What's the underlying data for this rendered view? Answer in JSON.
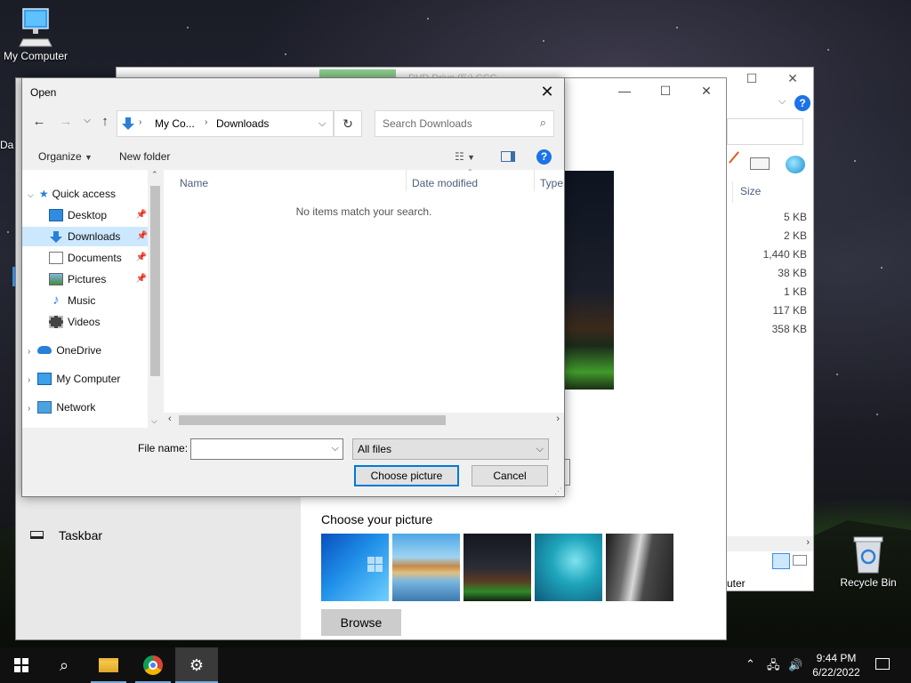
{
  "desktop": {
    "icons": {
      "my_computer": "My Computer",
      "recycle_bin": "Recycle Bin",
      "partial_left": "Da"
    }
  },
  "back_window": {
    "sizes": [
      "5 KB",
      "2 KB",
      "1,440 KB",
      "38 KB",
      "1 KB",
      "117 KB",
      "358 KB"
    ],
    "size_header": "Size",
    "footer_text": "uter",
    "faded_title": "DVD Drive (E:) CCC"
  },
  "settings": {
    "taskbar_label": "Taskbar",
    "choose_picture_heading": "Choose your picture",
    "browse_label": "Browse"
  },
  "dialog": {
    "title": "Open",
    "breadcrumb": [
      "My Co...",
      "Downloads"
    ],
    "search_placeholder": "Search Downloads",
    "toolbar": {
      "organize": "Organize",
      "new_folder": "New folder"
    },
    "nav": {
      "quick_access": "Quick access",
      "desktop": "Desktop",
      "downloads": "Downloads",
      "documents": "Documents",
      "pictures": "Pictures",
      "music": "Music",
      "videos": "Videos",
      "onedrive": "OneDrive",
      "my_computer": "My Computer",
      "network": "Network"
    },
    "columns": {
      "name": "Name",
      "date_modified": "Date modified",
      "type": "Type"
    },
    "empty_message": "No items match your search.",
    "file_name_label": "File name:",
    "file_name_value": "",
    "filter_value": "All files",
    "choose_button": "Choose picture",
    "cancel_button": "Cancel"
  },
  "taskbar": {
    "time": "9:44 PM",
    "date": "6/22/2022"
  },
  "colors": {
    "accent": "#0078d7",
    "selection": "#cce8ff",
    "help_blue": "#1a73e8"
  }
}
